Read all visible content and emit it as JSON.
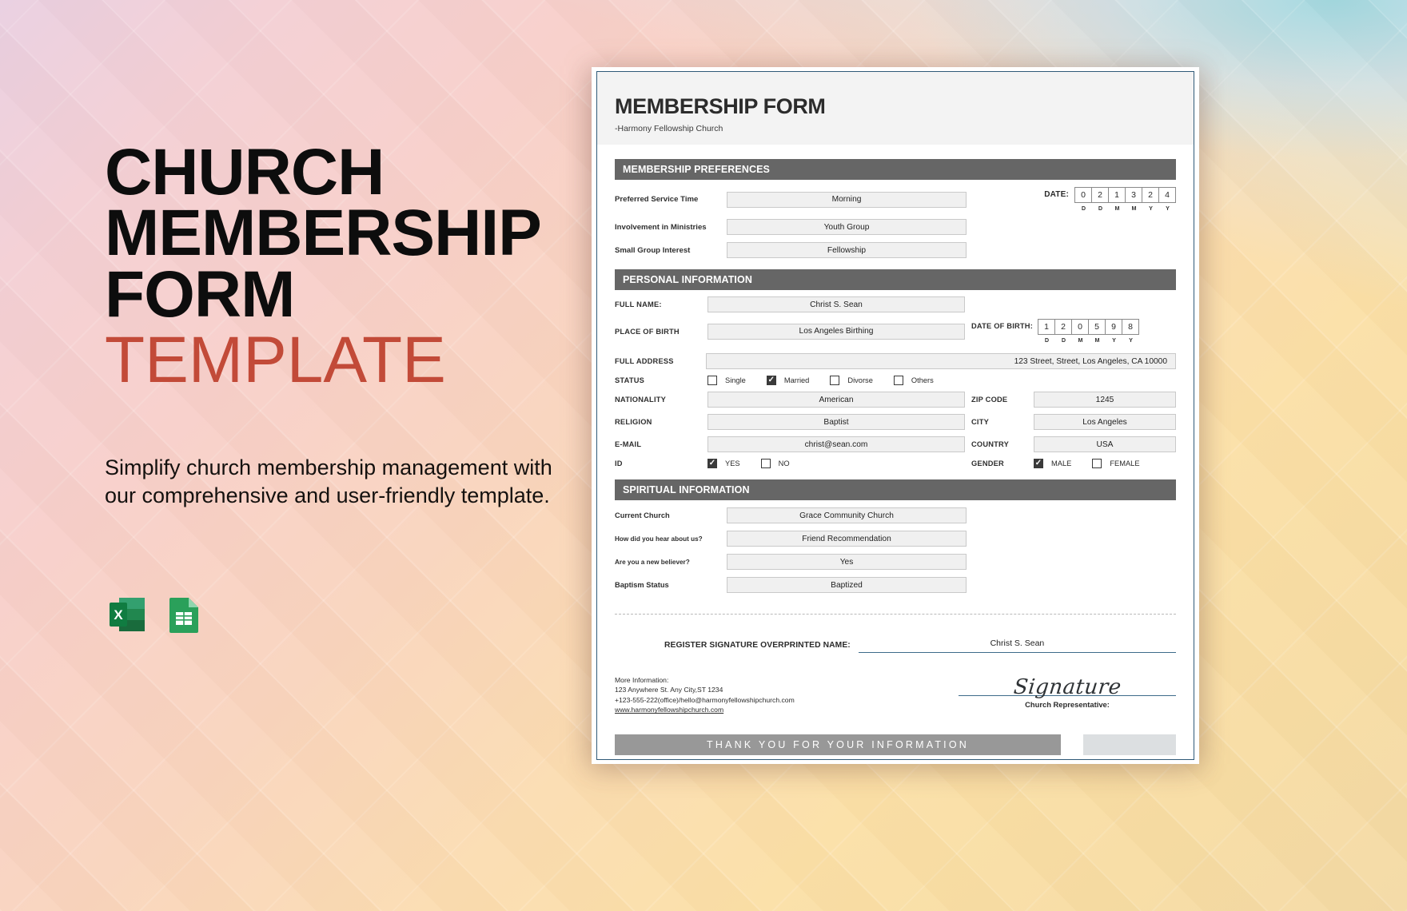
{
  "promo": {
    "title_lines": [
      "CHURCH",
      "MEMBERSHIP",
      "FORM"
    ],
    "title_accent": "TEMPLATE",
    "accent_color": "#c24a38",
    "description": "Simplify church membership management with our comprehensive and user-friendly template.",
    "file_icons": [
      {
        "name": "excel-icon",
        "label": "X"
      },
      {
        "name": "google-sheets-icon",
        "label": ""
      }
    ]
  },
  "document": {
    "header": {
      "title": "MEMBERSHIP FORM",
      "subtitle": "-Harmony Fellowship Church"
    },
    "membership_preferences": {
      "section_title": "MEMBERSHIP PREFERENCES",
      "fields": [
        {
          "label": "Preferred Service Time",
          "value": "Morning"
        },
        {
          "label": "Involvement in Ministries",
          "value": "Youth Group"
        },
        {
          "label": "Small Group Interest",
          "value": "Fellowship"
        }
      ],
      "date": {
        "label": "DATE:",
        "digits": [
          "0",
          "2",
          "1",
          "3",
          "2",
          "4"
        ],
        "captions": [
          "D",
          "D",
          "M",
          "M",
          "Y",
          "Y"
        ]
      }
    },
    "personal_information": {
      "section_title": "PERSONAL INFORMATION",
      "full_name": {
        "label": "FULL NAME:",
        "value": "Christ S. Sean"
      },
      "place_of_birth": {
        "label": "PLACE OF BIRTH",
        "value": "Los Angeles Birthing"
      },
      "date_of_birth": {
        "label": "DATE OF BIRTH:",
        "digits": [
          "1",
          "2",
          "0",
          "5",
          "9",
          "8"
        ],
        "captions": [
          "D",
          "D",
          "M",
          "M",
          "Y",
          "Y"
        ]
      },
      "full_address": {
        "label": "FULL ADDRESS",
        "value": "123 Street, Street, Los Angeles, CA 10000"
      },
      "status": {
        "label": "STATUS",
        "options": [
          {
            "text": "Single",
            "checked": false
          },
          {
            "text": "Married",
            "checked": true
          },
          {
            "text": "Divorse",
            "checked": false
          },
          {
            "text": "Others",
            "checked": false
          }
        ]
      },
      "nationality": {
        "label": "NATIONALITY",
        "value": "American"
      },
      "zip_code": {
        "label": "ZIP CODE",
        "value": "1245"
      },
      "religion": {
        "label": "RELIGION",
        "value": "Baptist"
      },
      "city": {
        "label": "CITY",
        "value": "Los Angeles"
      },
      "email": {
        "label": "E-MAIL",
        "value": "christ@sean.com"
      },
      "country": {
        "label": "COUNTRY",
        "value": "USA"
      },
      "id": {
        "label": "ID",
        "options": [
          {
            "text": "YES",
            "checked": true
          },
          {
            "text": "NO",
            "checked": false
          }
        ]
      },
      "gender": {
        "label": "GENDER",
        "options": [
          {
            "text": "MALE",
            "checked": true
          },
          {
            "text": "FEMALE",
            "checked": false
          }
        ]
      }
    },
    "spiritual_information": {
      "section_title": "SPIRITUAL INFORMATION",
      "fields": [
        {
          "label": "Current Church",
          "value": "Grace Community Church"
        },
        {
          "label": "How did you hear about us?",
          "value": "Friend Recommendation"
        },
        {
          "label": "Are you a new believer?",
          "value": "Yes"
        },
        {
          "label": "Baptism Status",
          "value": "Baptized"
        }
      ]
    },
    "signature": {
      "register_label": "REGISTER SIGNATURE OVERPRINTED NAME:",
      "register_value": "Christ S. Sean",
      "script": "Signature",
      "caption": "Church Representative:"
    },
    "more_information": {
      "heading": "More Information:",
      "address": "123 Anywhere St. Any City,ST 1234",
      "contact": "+123-555-222(office)/hello@harmonyfellowshipchurch.com",
      "website": "www.harmonyfellowshipchurch.com"
    },
    "footer": {
      "thank_you": "THANK YOU FOR YOUR INFORMATION"
    }
  }
}
